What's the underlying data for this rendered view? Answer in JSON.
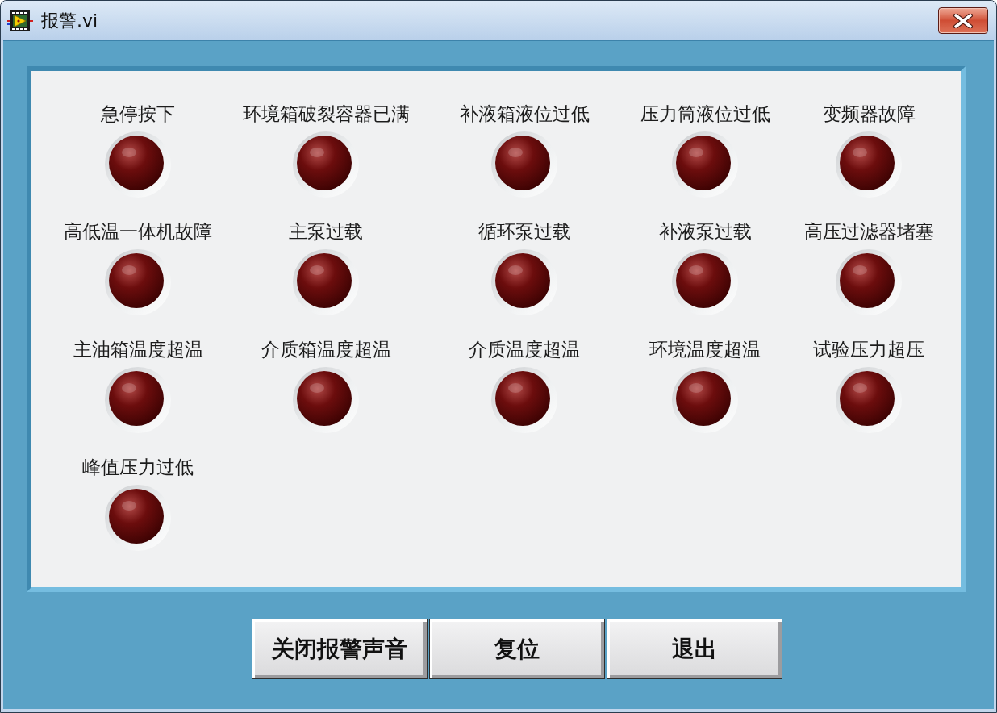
{
  "window": {
    "title": "报警.vi"
  },
  "indicators": [
    {
      "label": "急停按下",
      "on": false
    },
    {
      "label": "环境箱破裂容器已满",
      "on": false
    },
    {
      "label": "补液箱液位过低",
      "on": false
    },
    {
      "label": "压力筒液位过低",
      "on": false
    },
    {
      "label": "变频器故障",
      "on": false
    },
    {
      "label": "高低温一体机故障",
      "on": false
    },
    {
      "label": "主泵过载",
      "on": false
    },
    {
      "label": "循环泵过载",
      "on": false
    },
    {
      "label": "补液泵过载",
      "on": false
    },
    {
      "label": "高压过滤器堵塞",
      "on": false
    },
    {
      "label": "主油箱温度超温",
      "on": false
    },
    {
      "label": "介质箱温度超温",
      "on": false
    },
    {
      "label": "介质温度超温",
      "on": false
    },
    {
      "label": "环境温度超温",
      "on": false
    },
    {
      "label": "试验压力超压",
      "on": false
    },
    {
      "label": "峰值压力过低",
      "on": false
    }
  ],
  "buttons": [
    {
      "label": "关闭报警声音"
    },
    {
      "label": "复位"
    },
    {
      "label": "退出"
    }
  ]
}
